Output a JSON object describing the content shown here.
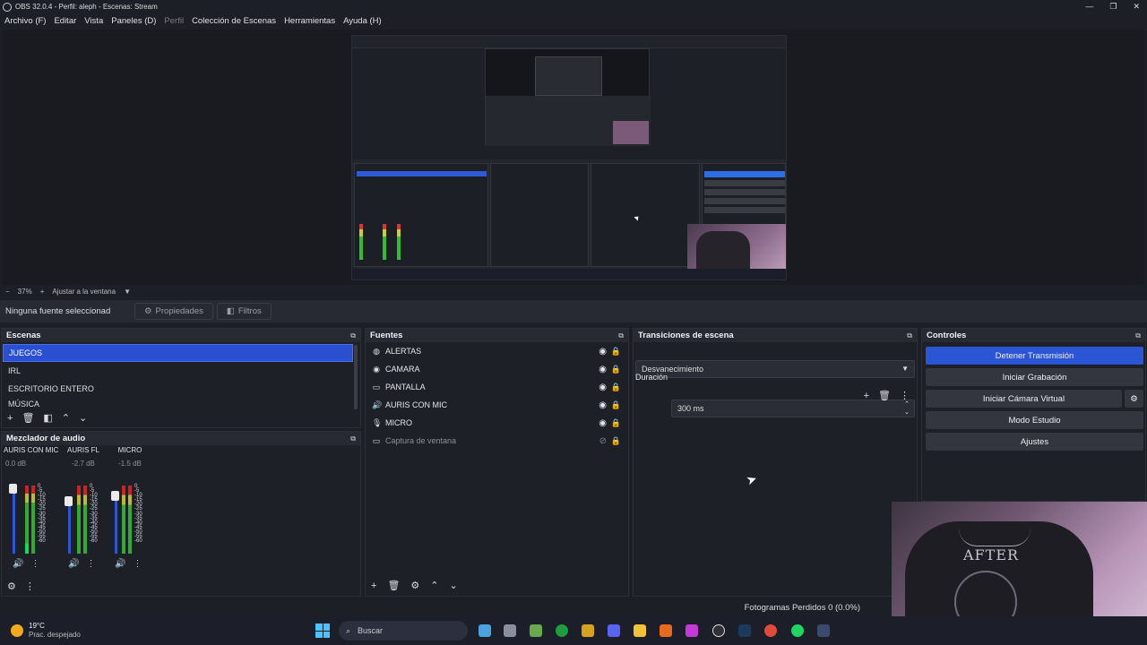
{
  "window": {
    "title": "OBS 32.0.4 - Perfil: aleph - Escenas: Stream",
    "minimize": "—",
    "maximize": "❐",
    "close": "✕"
  },
  "menu": [
    {
      "label": "Archivo (F)",
      "disabled": false
    },
    {
      "label": "Editar",
      "disabled": false
    },
    {
      "label": "Vista",
      "disabled": false
    },
    {
      "label": "Paneles (D)",
      "disabled": false
    },
    {
      "label": "Perfil",
      "disabled": true
    },
    {
      "label": "Colección de Escenas",
      "disabled": false
    },
    {
      "label": "Herramientas",
      "disabled": false
    },
    {
      "label": "Ayuda (H)",
      "disabled": false
    }
  ],
  "zoom": {
    "minus": "−",
    "value": "37%",
    "plus": "+",
    "fit": "Ajustar a la ventana",
    "arrow": "▼"
  },
  "source_toolbar": {
    "no_selection": "Ninguna fuente seleccionad",
    "properties": "Propiedades",
    "filters": "Filtros"
  },
  "scenes": {
    "title": "Escenas",
    "items": [
      "JUEGOS",
      "IRL",
      "ESCRITORIO ENTERO",
      "MÚSICA"
    ],
    "selected": "JUEGOS"
  },
  "sources": {
    "title": "Fuentes",
    "items": [
      {
        "name": "ALERTAS",
        "icon": "globe-icon",
        "glyph": "◍",
        "visible": true
      },
      {
        "name": "CAMARA",
        "icon": "camera-icon",
        "glyph": "◉",
        "visible": true
      },
      {
        "name": "PANTALLA",
        "icon": "monitor-icon",
        "glyph": "▭",
        "visible": true
      },
      {
        "name": "AURIS CON MIC",
        "icon": "speaker-icon",
        "glyph": "🔊",
        "visible": true
      },
      {
        "name": "MICRO",
        "icon": "mic-icon",
        "glyph": "🎙",
        "visible": true
      },
      {
        "name": "Captura de ventana",
        "icon": "window-icon",
        "glyph": "▭",
        "visible": false
      }
    ]
  },
  "transitions": {
    "title": "Transiciones de escena",
    "transition": "Desvanecimiento",
    "duration_label": "Duración",
    "duration_value": "300 ms"
  },
  "controls": {
    "title": "Controles",
    "stop_stream": "Detener Transmisión",
    "start_recording": "Iniciar Grabación",
    "start_virtual_cam": "Iniciar Cámara Virtual",
    "studio_mode": "Modo Estudio",
    "settings": "Ajustes"
  },
  "mixer": {
    "title": "Mezclador de audio",
    "channels": [
      {
        "name": "AURIS CON MIC",
        "db": "0.0 dB"
      },
      {
        "name": "AURIS FL",
        "db": "-2.7 dB"
      },
      {
        "name": "MICRO",
        "db": "-1.5 dB"
      }
    ],
    "scale": [
      "0",
      "-5",
      "-10",
      "-15",
      "-20",
      "-25",
      "-30",
      "-35",
      "-40",
      "-45",
      "-50",
      "-55",
      "-60"
    ]
  },
  "status": {
    "dropped_frames": "Fotogramas Perdidos 0 (0.0%)"
  },
  "taskbar": {
    "temperature": "19°C",
    "condition": "Prac. despejado",
    "search": "Buscar"
  },
  "webcam": {
    "shirt_text": "AFTER"
  },
  "colors": {
    "accent": "#2a56d6",
    "panel": "#1e2028",
    "header": "#272a33",
    "background": "#1d1f26"
  }
}
